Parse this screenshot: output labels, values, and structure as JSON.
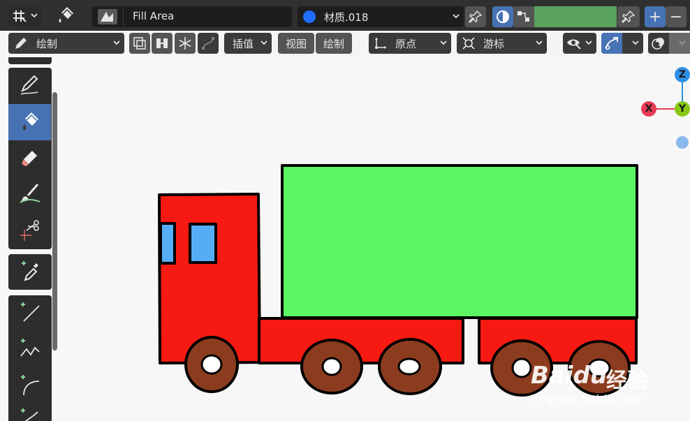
{
  "header": {
    "editor_type_icon": "grid-editor-icon",
    "tool_icon": "fill-bucket-icon",
    "tool_name": "Fill Area",
    "material_name": "材质.018",
    "material_color": "#1f6dff",
    "plus_label": "+",
    "minus_label": "−",
    "swatch_color": "#59a35e"
  },
  "toolbar2": {
    "mode_label": "绘制",
    "interp_label": "插值",
    "view_label": "视图",
    "draw_label": "绘制",
    "origin_label": "原点",
    "cursor_label": "游标"
  },
  "tools": [
    {
      "name": "pen-tool"
    },
    {
      "name": "fill-tool"
    },
    {
      "name": "eraser-tool"
    },
    {
      "name": "tint-tool"
    },
    {
      "name": "cutter-tool"
    },
    {
      "name": "eyedropper-tool"
    },
    {
      "name": "line-tool"
    },
    {
      "name": "polyline-tool"
    },
    {
      "name": "arc-tool"
    },
    {
      "name": "curve-tool"
    }
  ],
  "gizmo": {
    "z_label": "Z",
    "x_label": "X",
    "y_label": "Y",
    "z_color": "#2f8fe6",
    "x_color": "#e63a55",
    "y_color": "#86c813"
  },
  "canvas": {
    "cab_color": "#f71a12",
    "cargo_color": "#5cf564",
    "window_color": "#55aef5",
    "wheel_color": "#8b3c1e",
    "chassis_color": "#f71a12"
  },
  "watermark": {
    "brand": "Baidu",
    "text": "经验",
    "url": "jingyan.baidu.com"
  }
}
